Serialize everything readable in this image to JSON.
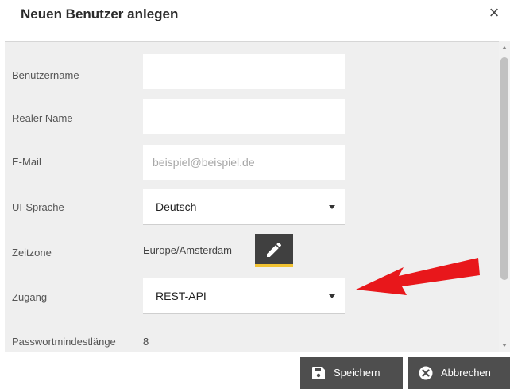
{
  "dialog": {
    "title": "Neuen Benutzer anlegen",
    "close_icon": "×"
  },
  "form": {
    "username": {
      "label": "Benutzername",
      "value": ""
    },
    "real_name": {
      "label": "Realer Name",
      "value": ""
    },
    "email": {
      "label": "E-Mail",
      "value": "",
      "placeholder": "beispiel@beispiel.de"
    },
    "ui_language": {
      "label": "UI-Sprache",
      "value": "Deutsch"
    },
    "timezone": {
      "label": "Zeitzone",
      "value": "Europe/Amsterdam"
    },
    "access": {
      "label": "Zugang",
      "value": "REST-API"
    },
    "min_password_length": {
      "label": "Passwortmindestlänge",
      "value": "8"
    }
  },
  "buttons": {
    "save": {
      "label": "Speichern",
      "icon": "floppy-disk-icon"
    },
    "cancel": {
      "label": "Abbrechen",
      "icon": "close-circle-icon"
    }
  },
  "colors": {
    "button_bg": "#4e4e4e",
    "accent_underline": "#f1c232",
    "arrow": "#e8171b"
  }
}
